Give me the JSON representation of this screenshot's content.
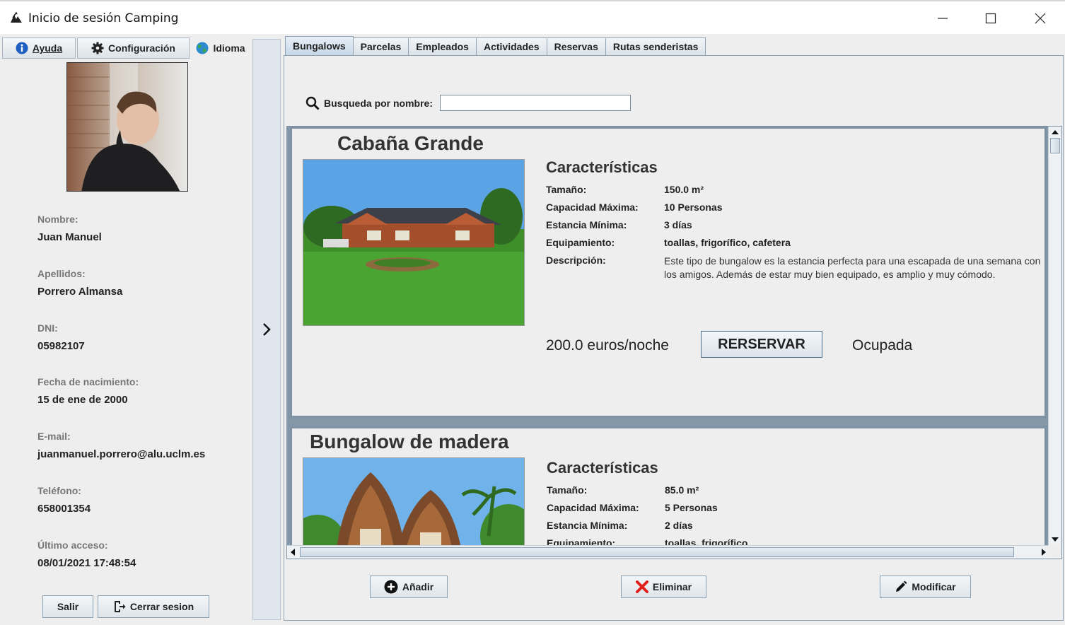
{
  "window": {
    "title": "Inicio de sesión Camping",
    "controls": [
      "minimize-icon",
      "maximize-icon",
      "close-icon"
    ]
  },
  "sidebar": {
    "toolbar": {
      "help_label": "Ayuda",
      "config_label": "Configuración",
      "language_label": "Idioma"
    },
    "profile": {
      "name_label": "Nombre:",
      "name_value": "Juan Manuel",
      "surname_label": "Apellidos:",
      "surname_value": "Porrero Almansa",
      "dni_label": "DNI:",
      "dni_value": "05982107",
      "birth_label": "Fecha de nacimiento:",
      "birth_value": "15 de ene de 2000",
      "email_label": "E-mail:",
      "email_value": "juanmanuel.porrero@alu.uclm.es",
      "phone_label": "Teléfono:",
      "phone_value": "658001354",
      "last_access_label": "Último acceso:",
      "last_access_value": "08/01/2021 17:48:54"
    },
    "buttons": {
      "exit_label": "Salir",
      "logout_label": "Cerrar sesion"
    }
  },
  "tabs": [
    {
      "label": "Bungalows",
      "active": true
    },
    {
      "label": "Parcelas",
      "active": false
    },
    {
      "label": "Empleados",
      "active": false
    },
    {
      "label": "Actividades",
      "active": false
    },
    {
      "label": "Reservas",
      "active": false
    },
    {
      "label": "Rutas senderistas",
      "active": false
    }
  ],
  "search": {
    "label": "Busqueda por nombre:",
    "value": ""
  },
  "bungalows": [
    {
      "name": "Cabaña Grande",
      "features_title": "Características",
      "size_label": "Tamaño:",
      "size_value": "150.0 m²",
      "capacity_label": "Capacidad Máxima:",
      "capacity_value": "10 Personas",
      "min_stay_label": "Estancia Mínima:",
      "min_stay_value": "3 días",
      "equipment_label": "Equipamiento:",
      "equipment_value": "toallas, frigorífico, cafetera",
      "description_label": "Descripción:",
      "description_value": "Este tipo de bungalow es la estancia perfecta para una escapada de una semana con los amigos. Además de estar muy bien equipado, es amplio y muy cómodo.",
      "price": "200.0 euros/noche",
      "reserve_label": "RERSERVAR",
      "status": "Ocupada"
    },
    {
      "name": "Bungalow de madera",
      "features_title": "Características",
      "size_label": "Tamaño:",
      "size_value": "85.0 m²",
      "capacity_label": "Capacidad Máxima:",
      "capacity_value": "5 Personas",
      "min_stay_label": "Estancia Mínima:",
      "min_stay_value": "2 días",
      "equipment_label": "Equipamiento:",
      "equipment_value": "toallas, frigorífico"
    }
  ],
  "actions": {
    "add_label": "Añadir",
    "delete_label": "Eliminar",
    "modify_label": "Modificar"
  },
  "colors": {
    "accent": "#8fa3b4",
    "delete_icon": "#e0201b",
    "info_icon": "#1f5fbf"
  }
}
